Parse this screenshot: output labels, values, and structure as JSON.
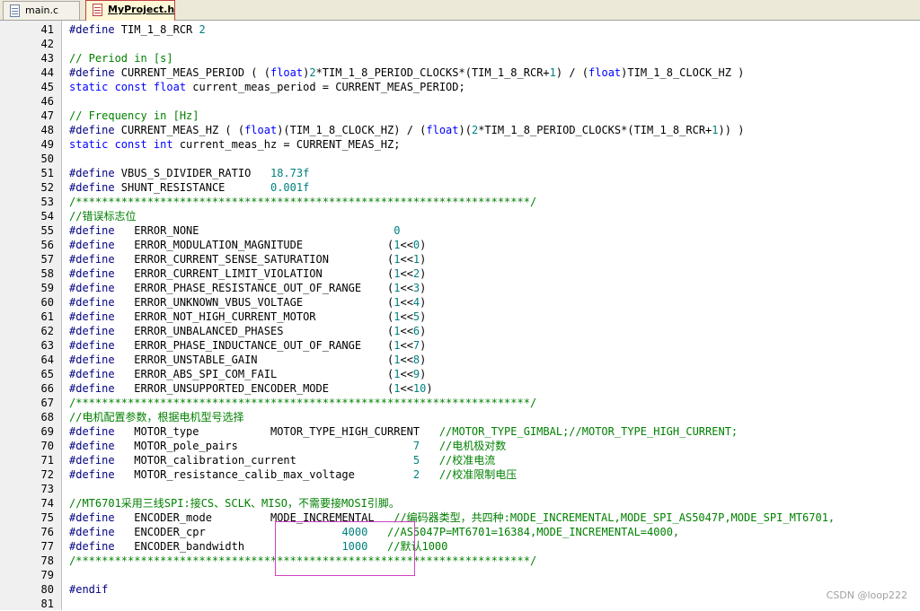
{
  "tabs": [
    {
      "label": "main.c",
      "icon": "c-file-icon",
      "active": false
    },
    {
      "label": "MyProject.h",
      "icon": "header-file-icon",
      "active": true
    }
  ],
  "lines": [
    {
      "n": "41",
      "t": [
        [
          "pp",
          "#define "
        ],
        [
          "",
          "TIM_1_8_RCR "
        ],
        [
          "num",
          "2"
        ]
      ]
    },
    {
      "n": "42",
      "t": []
    },
    {
      "n": "43",
      "t": [
        [
          "cm",
          "// Period in [s]"
        ]
      ]
    },
    {
      "n": "44",
      "t": [
        [
          "pp",
          "#define "
        ],
        [
          "",
          "CURRENT_MEAS_PERIOD ( ("
        ],
        [
          "kw",
          "float"
        ],
        [
          "",
          ")"
        ],
        [
          "num",
          "2"
        ],
        [
          "",
          "*TIM_1_8_PERIOD_CLOCKS*(TIM_1_8_RCR+"
        ],
        [
          "num",
          "1"
        ],
        [
          "",
          ") / ("
        ],
        [
          "kw",
          "float"
        ],
        [
          "",
          ")TIM_1_8_CLOCK_HZ )"
        ]
      ]
    },
    {
      "n": "45",
      "t": [
        [
          "kw",
          "static const float "
        ],
        [
          "",
          "current_meas_period = CURRENT_MEAS_PERIOD;"
        ]
      ]
    },
    {
      "n": "46",
      "t": []
    },
    {
      "n": "47",
      "t": [
        [
          "cm",
          "// Frequency in [Hz]"
        ]
      ]
    },
    {
      "n": "48",
      "t": [
        [
          "pp",
          "#define "
        ],
        [
          "",
          "CURRENT_MEAS_HZ ( ("
        ],
        [
          "kw",
          "float"
        ],
        [
          "",
          ")(TIM_1_8_CLOCK_HZ) / ("
        ],
        [
          "kw",
          "float"
        ],
        [
          "",
          ")("
        ],
        [
          "num",
          "2"
        ],
        [
          "",
          "*TIM_1_8_PERIOD_CLOCKS*(TIM_1_8_RCR+"
        ],
        [
          "num",
          "1"
        ],
        [
          "",
          ")) )"
        ]
      ]
    },
    {
      "n": "49",
      "t": [
        [
          "kw",
          "static const int "
        ],
        [
          "",
          "current_meas_hz = CURRENT_MEAS_HZ;"
        ]
      ]
    },
    {
      "n": "50",
      "t": []
    },
    {
      "n": "51",
      "t": [
        [
          "pp",
          "#define "
        ],
        [
          "",
          "VBUS_S_DIVIDER_RATIO   "
        ],
        [
          "num",
          "18.73f"
        ]
      ]
    },
    {
      "n": "52",
      "t": [
        [
          "pp",
          "#define "
        ],
        [
          "",
          "SHUNT_RESISTANCE       "
        ],
        [
          "num",
          "0.001f"
        ]
      ]
    },
    {
      "n": "53",
      "t": [
        [
          "cm",
          "/**********************************************************************/"
        ]
      ]
    },
    {
      "n": "54",
      "t": [
        [
          "cm",
          "//错误标志位"
        ]
      ]
    },
    {
      "n": "55",
      "t": [
        [
          "pp",
          "#define "
        ],
        [
          "",
          "  ERROR_NONE                              "
        ],
        [
          "num",
          "0"
        ]
      ]
    },
    {
      "n": "56",
      "t": [
        [
          "pp",
          "#define "
        ],
        [
          "",
          "  ERROR_MODULATION_MAGNITUDE             ("
        ],
        [
          "num",
          "1"
        ],
        [
          "",
          "<<"
        ],
        [
          "num",
          "0"
        ],
        [
          "",
          ")"
        ]
      ]
    },
    {
      "n": "57",
      "t": [
        [
          "pp",
          "#define "
        ],
        [
          "",
          "  ERROR_CURRENT_SENSE_SATURATION         ("
        ],
        [
          "num",
          "1"
        ],
        [
          "",
          "<<"
        ],
        [
          "num",
          "1"
        ],
        [
          "",
          ")"
        ]
      ]
    },
    {
      "n": "58",
      "t": [
        [
          "pp",
          "#define "
        ],
        [
          "",
          "  ERROR_CURRENT_LIMIT_VIOLATION          ("
        ],
        [
          "num",
          "1"
        ],
        [
          "",
          "<<"
        ],
        [
          "num",
          "2"
        ],
        [
          "",
          ")"
        ]
      ]
    },
    {
      "n": "59",
      "t": [
        [
          "pp",
          "#define "
        ],
        [
          "",
          "  ERROR_PHASE_RESISTANCE_OUT_OF_RANGE    ("
        ],
        [
          "num",
          "1"
        ],
        [
          "",
          "<<"
        ],
        [
          "num",
          "3"
        ],
        [
          "",
          ")"
        ]
      ]
    },
    {
      "n": "60",
      "t": [
        [
          "pp",
          "#define "
        ],
        [
          "",
          "  ERROR_UNKNOWN_VBUS_VOLTAGE             ("
        ],
        [
          "num",
          "1"
        ],
        [
          "",
          "<<"
        ],
        [
          "num",
          "4"
        ],
        [
          "",
          ")"
        ]
      ]
    },
    {
      "n": "61",
      "t": [
        [
          "pp",
          "#define "
        ],
        [
          "",
          "  ERROR_NOT_HIGH_CURRENT_MOTOR           ("
        ],
        [
          "num",
          "1"
        ],
        [
          "",
          "<<"
        ],
        [
          "num",
          "5"
        ],
        [
          "",
          ")"
        ]
      ]
    },
    {
      "n": "62",
      "t": [
        [
          "pp",
          "#define "
        ],
        [
          "",
          "  ERROR_UNBALANCED_PHASES                ("
        ],
        [
          "num",
          "1"
        ],
        [
          "",
          "<<"
        ],
        [
          "num",
          "6"
        ],
        [
          "",
          ")"
        ]
      ]
    },
    {
      "n": "63",
      "t": [
        [
          "pp",
          "#define "
        ],
        [
          "",
          "  ERROR_PHASE_INDUCTANCE_OUT_OF_RANGE    ("
        ],
        [
          "num",
          "1"
        ],
        [
          "",
          "<<"
        ],
        [
          "num",
          "7"
        ],
        [
          "",
          ")"
        ]
      ]
    },
    {
      "n": "64",
      "t": [
        [
          "pp",
          "#define "
        ],
        [
          "",
          "  ERROR_UNSTABLE_GAIN                    ("
        ],
        [
          "num",
          "1"
        ],
        [
          "",
          "<<"
        ],
        [
          "num",
          "8"
        ],
        [
          "",
          ")"
        ]
      ]
    },
    {
      "n": "65",
      "t": [
        [
          "pp",
          "#define "
        ],
        [
          "",
          "  ERROR_ABS_SPI_COM_FAIL                 ("
        ],
        [
          "num",
          "1"
        ],
        [
          "",
          "<<"
        ],
        [
          "num",
          "9"
        ],
        [
          "",
          ")"
        ]
      ]
    },
    {
      "n": "66",
      "t": [
        [
          "pp",
          "#define "
        ],
        [
          "",
          "  ERROR_UNSUPPORTED_ENCODER_MODE         ("
        ],
        [
          "num",
          "1"
        ],
        [
          "",
          "<<"
        ],
        [
          "num",
          "10"
        ],
        [
          "",
          ")"
        ]
      ]
    },
    {
      "n": "67",
      "t": [
        [
          "cm",
          "/**********************************************************************/"
        ]
      ]
    },
    {
      "n": "68",
      "t": [
        [
          "cm",
          "//电机配置参数，根据电机型号选择"
        ]
      ]
    },
    {
      "n": "69",
      "t": [
        [
          "pp",
          "#define "
        ],
        [
          "",
          "  MOTOR_type           MOTOR_TYPE_HIGH_CURRENT   "
        ],
        [
          "cm",
          "//MOTOR_TYPE_GIMBAL;//MOTOR_TYPE_HIGH_CURRENT;"
        ]
      ]
    },
    {
      "n": "70",
      "t": [
        [
          "pp",
          "#define "
        ],
        [
          "",
          "  MOTOR_pole_pairs                           "
        ],
        [
          "num",
          "7"
        ],
        [
          "",
          "   "
        ],
        [
          "cm",
          "//电机极对数"
        ]
      ]
    },
    {
      "n": "71",
      "t": [
        [
          "pp",
          "#define "
        ],
        [
          "",
          "  MOTOR_calibration_current                  "
        ],
        [
          "num",
          "5"
        ],
        [
          "",
          "   "
        ],
        [
          "cm",
          "//校准电流"
        ]
      ]
    },
    {
      "n": "72",
      "t": [
        [
          "pp",
          "#define "
        ],
        [
          "",
          "  MOTOR_resistance_calib_max_voltage         "
        ],
        [
          "num",
          "2"
        ],
        [
          "",
          "   "
        ],
        [
          "cm",
          "//校准限制电压"
        ]
      ]
    },
    {
      "n": "73",
      "t": []
    },
    {
      "n": "74",
      "t": [
        [
          "cm",
          "//MT6701采用三线SPI:接CS、SCLK、MISO，不需要接MOSI引脚。"
        ]
      ]
    },
    {
      "n": "75",
      "t": [
        [
          "pp",
          "#define "
        ],
        [
          "",
          "  ENCODER_mode         MODE_INCREMENTAL   "
        ],
        [
          "cm",
          "//编码器类型，共四种:MODE_INCREMENTAL,MODE_SPI_AS5047P,MODE_SPI_MT6701,"
        ]
      ]
    },
    {
      "n": "76",
      "t": [
        [
          "pp",
          "#define "
        ],
        [
          "",
          "  ENCODER_cpr                     "
        ],
        [
          "num",
          "4000"
        ],
        [
          "",
          "   "
        ],
        [
          "cm",
          "//AS5047P=MT6701=16384,MODE_INCREMENTAL=4000,"
        ]
      ]
    },
    {
      "n": "77",
      "t": [
        [
          "pp",
          "#define "
        ],
        [
          "",
          "  ENCODER_bandwidth               "
        ],
        [
          "num",
          "1000"
        ],
        [
          "",
          "   "
        ],
        [
          "cm",
          "//默认1000"
        ]
      ]
    },
    {
      "n": "78",
      "t": [
        [
          "cm",
          "/**********************************************************************/"
        ]
      ]
    },
    {
      "n": "79",
      "t": []
    },
    {
      "n": "80",
      "t": [
        [
          "pp",
          "#endif"
        ]
      ]
    },
    {
      "n": "81",
      "t": []
    }
  ],
  "watermark": "CSDN @loop222"
}
